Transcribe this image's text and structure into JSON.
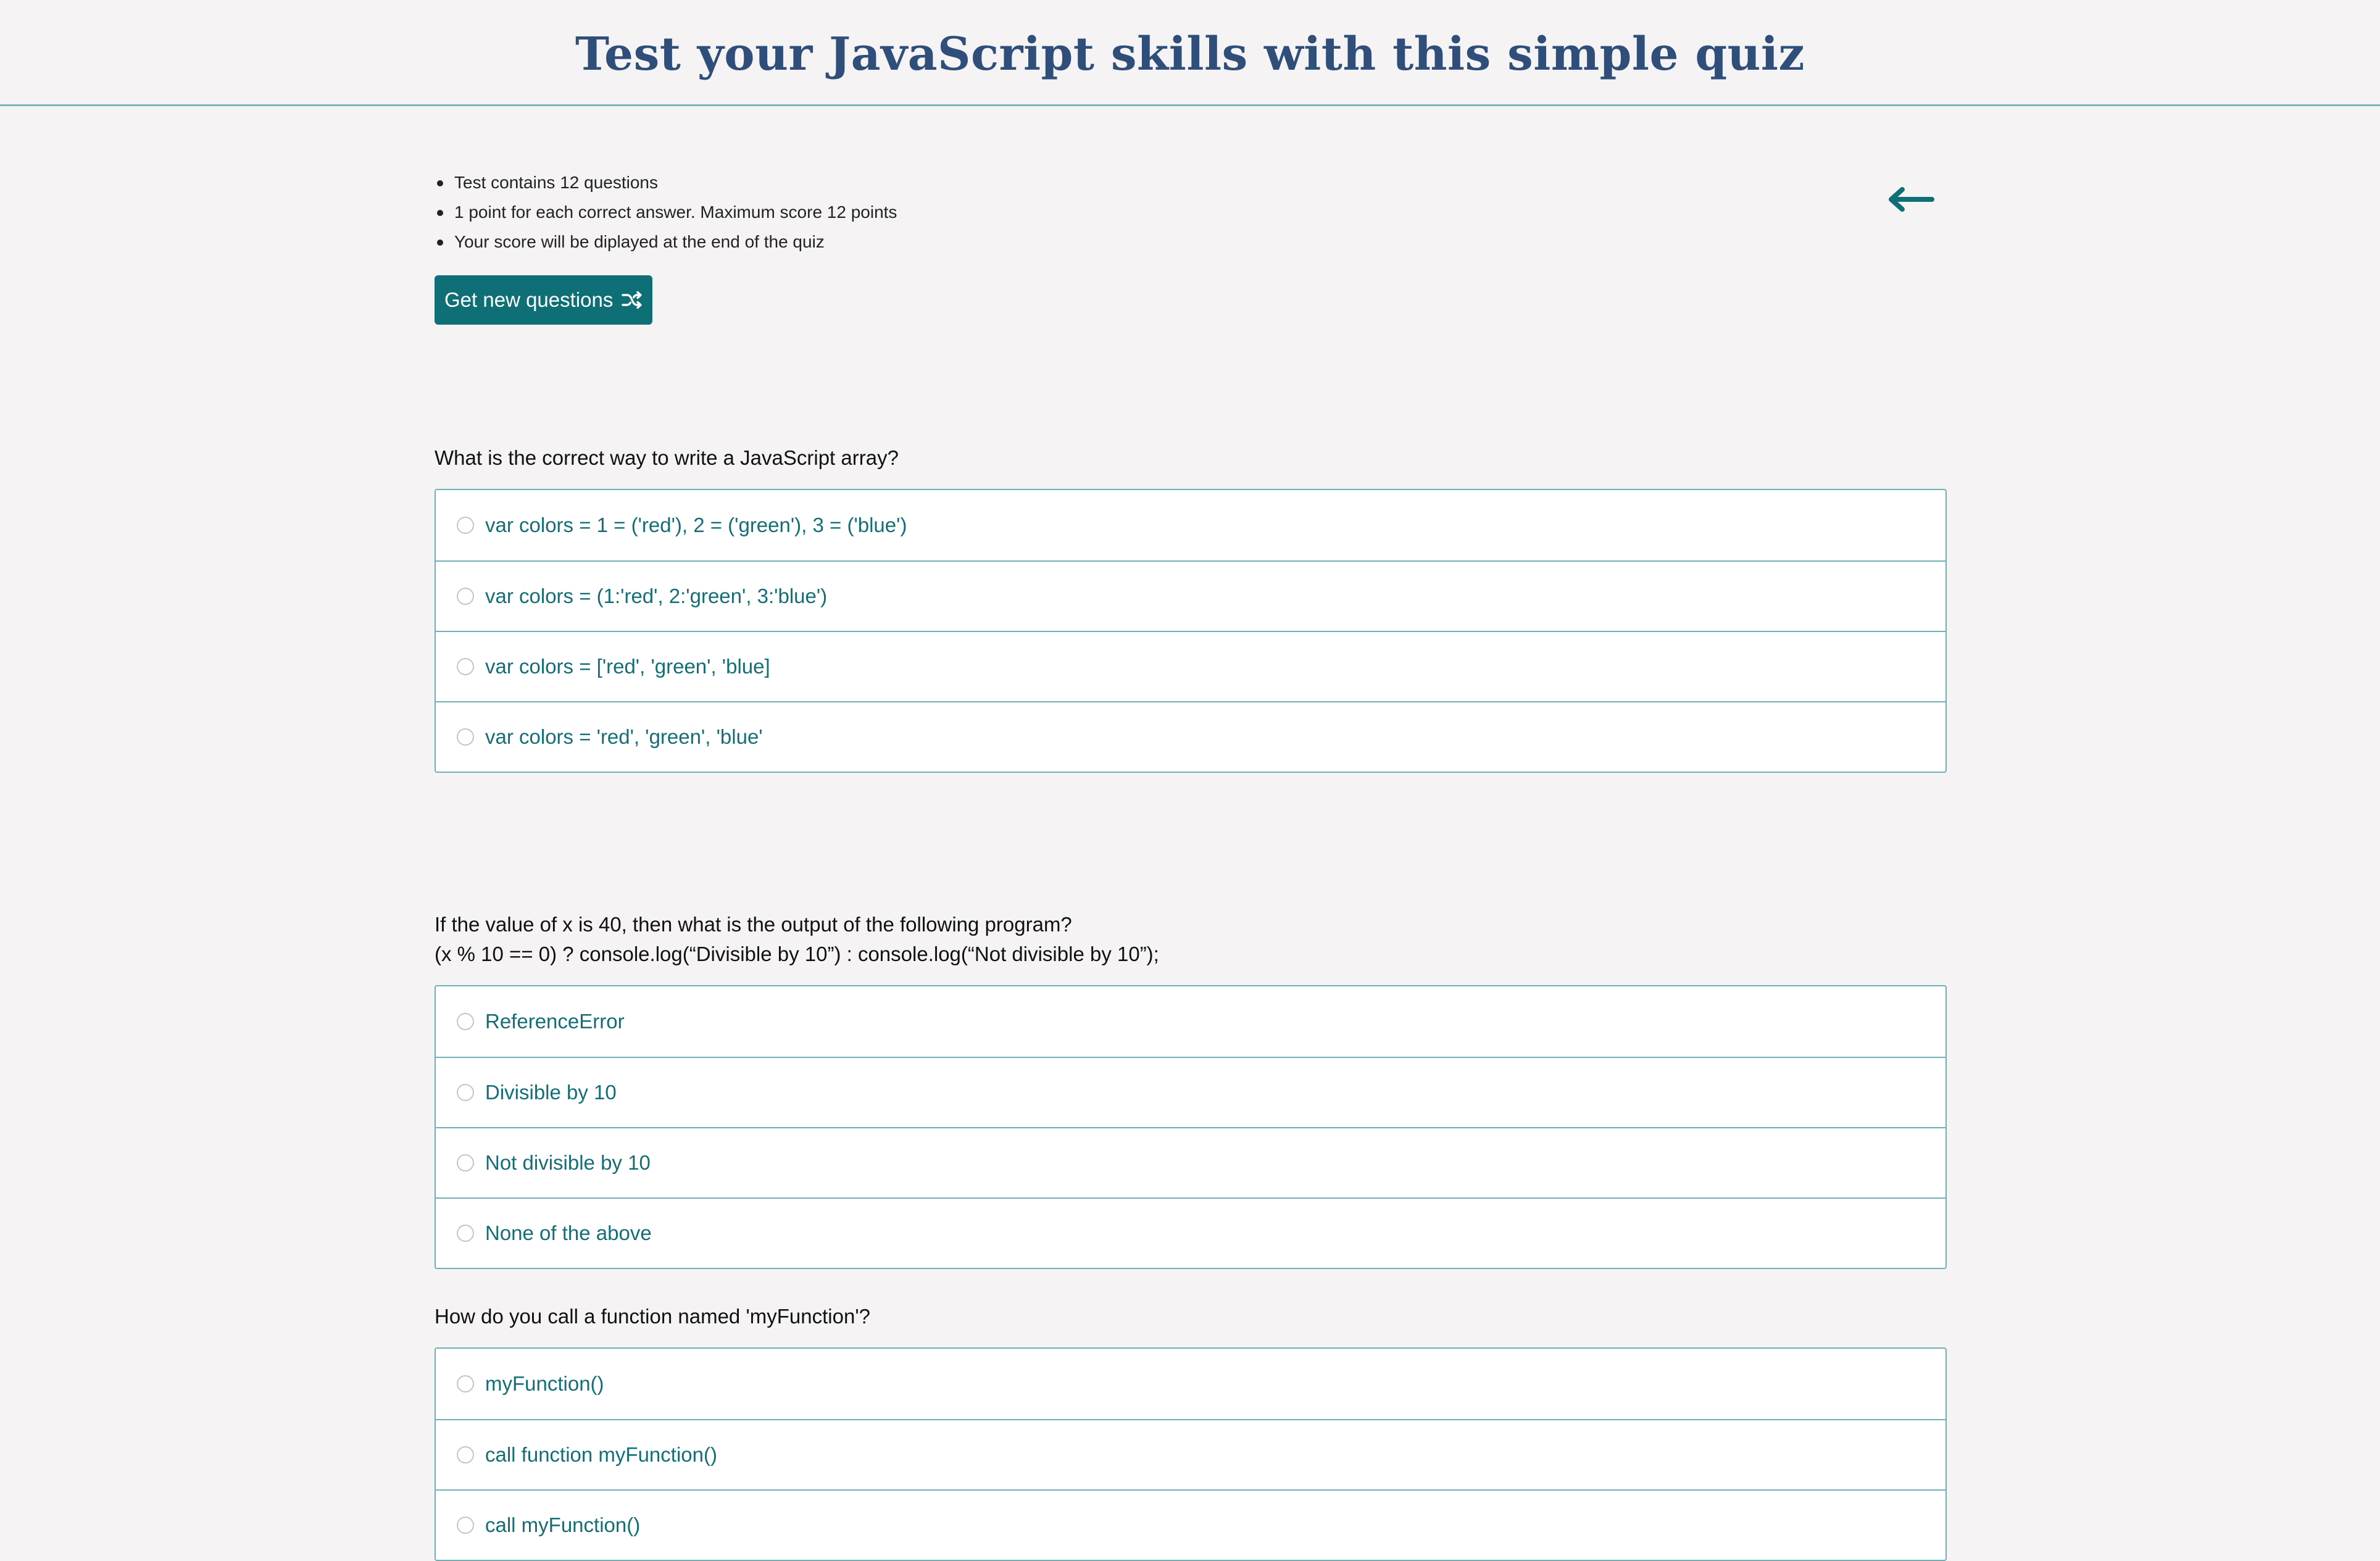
{
  "header": {
    "title": "Test your JavaScript skills with this simple quiz"
  },
  "info": [
    "Test contains 12 questions",
    "1 point for each correct answer. Maximum score 12 points",
    "Your score will be diplayed at the end of the quiz"
  ],
  "actions": {
    "new_questions_label": "Get new questions",
    "new_questions_icon": "shuffle-icon",
    "back_icon": "arrow-left-icon"
  },
  "colors": {
    "title": "#2f4f7a",
    "accent": "#0f6f76",
    "border": "#6fb0b6",
    "background": "#f5f3f4"
  },
  "questions": [
    {
      "text": "What is the correct way to write a JavaScript array?",
      "options": [
        "var colors = 1 = ('red'), 2 = ('green'), 3 = ('blue')",
        "var colors = (1:'red', 2:'green', 3:'blue')",
        "var colors = ['red', 'green', 'blue]",
        "var colors = 'red', 'green', 'blue'"
      ]
    },
    {
      "text": "If the value of x is 40, then what is the output of the following program?",
      "code": "(x % 10 == 0) ? console.log(“Divisible by 10”) : console.log(“Not divisible by 10”);",
      "options": [
        "ReferenceError",
        "Divisible by 10",
        "Not divisible by 10",
        "None of the above"
      ]
    },
    {
      "text": "How do you call a function named 'myFunction'?",
      "options": [
        "myFunction()",
        "call function myFunction()",
        "call myFunction()"
      ]
    }
  ]
}
